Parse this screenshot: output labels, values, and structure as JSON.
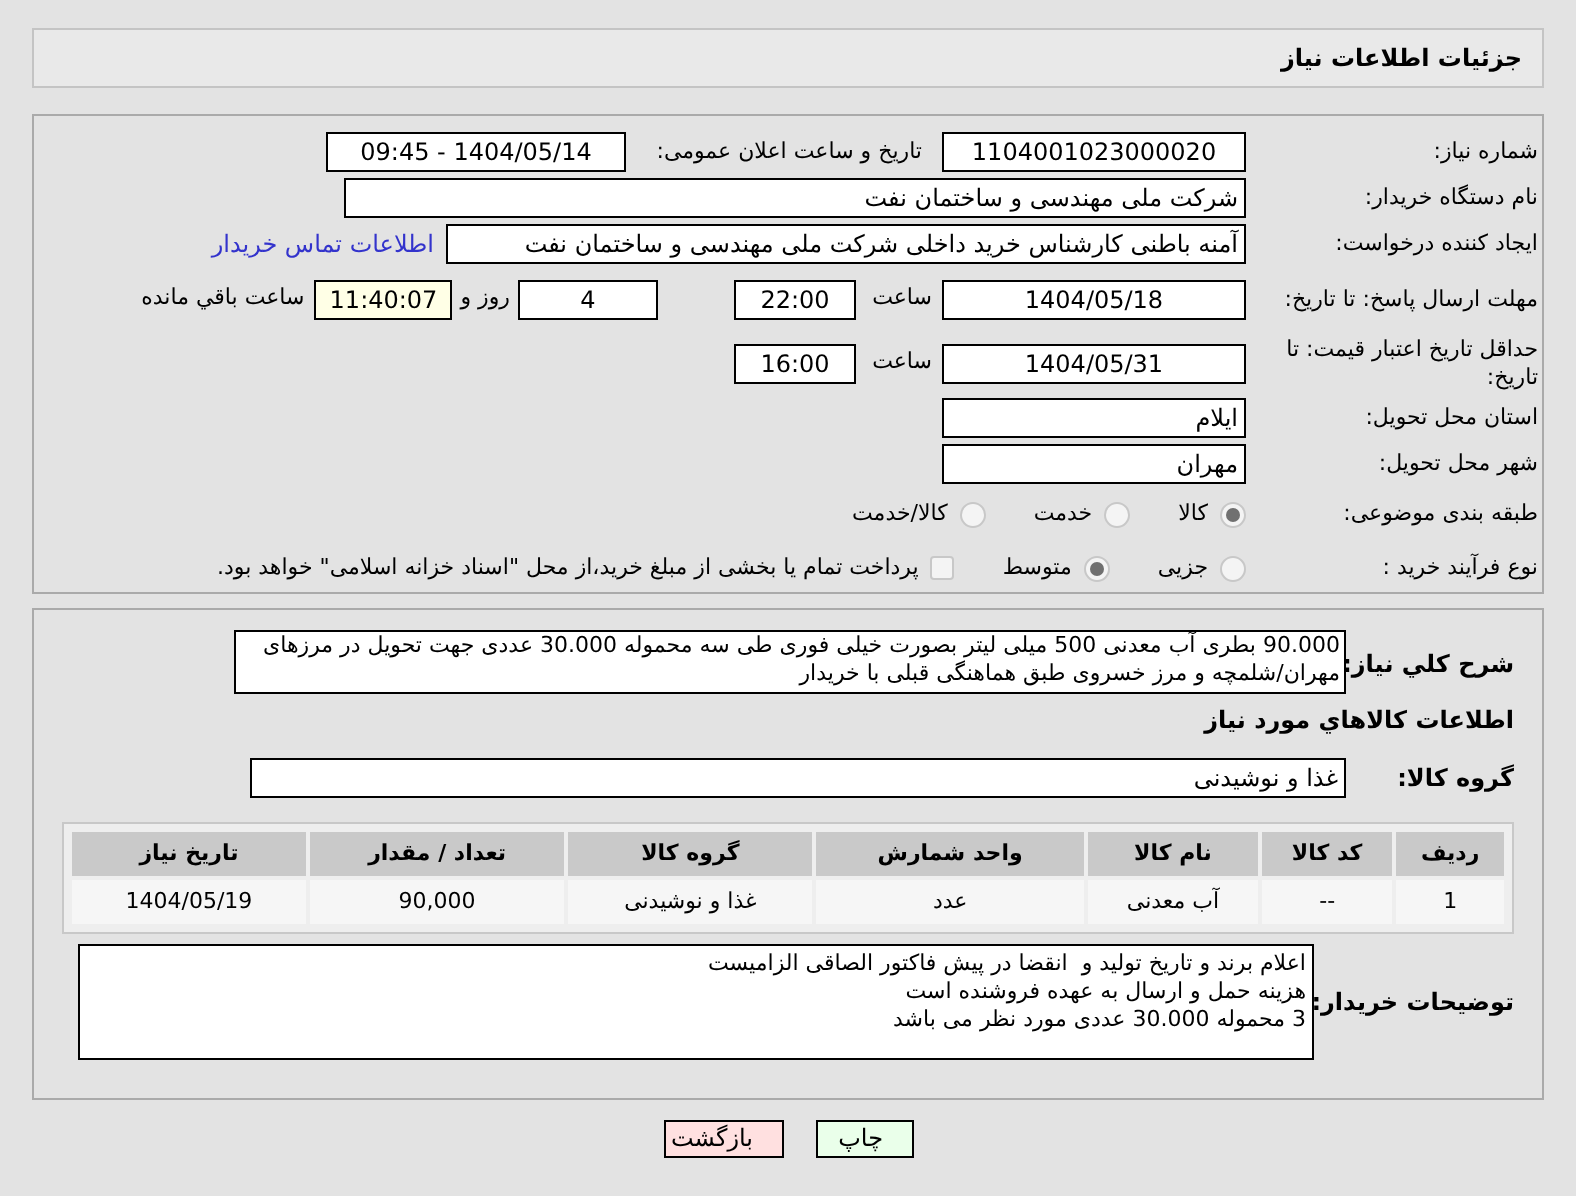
{
  "title": "جزئیات اطلاعات نیاز",
  "need_number": {
    "label": "شماره نیاز:",
    "value": "1104001023000020"
  },
  "announce": {
    "label": "تاریخ و ساعت اعلان عمومی:",
    "value": "1404/05/14 - 09:45"
  },
  "buyer": {
    "label": "نام دستگاه خریدار:",
    "value": "شرکت ملی مهندسی و ساختمان نفت"
  },
  "requester": {
    "label": "ایجاد کننده درخواست:",
    "value": "آمنه باطنی کارشناس خرید داخلی شرکت ملی مهندسی و ساختمان نفت",
    "link": "اطلاعات تماس خریدار"
  },
  "deadline": {
    "label": "مهلت ارسال پاسخ: تا تاریخ:",
    "date": "1404/05/18",
    "time_label": "ساعت",
    "time": "22:00",
    "days": "4",
    "days_label": "روز و",
    "remaining": "11:40:07",
    "remaining_label": "ساعت باقي مانده"
  },
  "validity": {
    "label": "حداقل تاریخ اعتبار قیمت: تا تاریخ:",
    "date": "1404/05/31",
    "time_label": "ساعت",
    "time": "16:00"
  },
  "province": {
    "label": "استان محل تحویل:",
    "value": "ایلام"
  },
  "city": {
    "label": "شهر محل تحویل:",
    "value": "مهران"
  },
  "category": {
    "label": "طبقه بندی موضوعی:",
    "options": [
      {
        "label": "کالا",
        "selected": true
      },
      {
        "label": "خدمت",
        "selected": false
      },
      {
        "label": "کالا/خدمت",
        "selected": false
      }
    ]
  },
  "process": {
    "label": "نوع فرآیند خرید :",
    "options": [
      {
        "label": "جزیی",
        "selected": false
      },
      {
        "label": "متوسط",
        "selected": true
      }
    ],
    "treasury": {
      "label": "پرداخت تمام یا بخشی از مبلغ خرید،از محل \"اسناد خزانه اسلامی\" خواهد بود.",
      "checked": false
    }
  },
  "description": {
    "label": "شرح کلي نياز:",
    "value": "90.000 بطری آب معدنی 500 میلی لیتر بصورت خیلی فوری طی سه محموله  30.000 عددی جهت تحویل در مرزهای مهران/شلمچه و مرز خسروی طبق هماهنگی قبلی با خریدار"
  },
  "goods_heading": "اطلاعات کالاهاي مورد نياز",
  "goods_group": {
    "label": "گروه کالا:",
    "value": "غذا و نوشیدنی"
  },
  "table": {
    "columns": [
      "ردیف",
      "کد کالا",
      "نام کالا",
      "واحد شمارش",
      "گروه کالا",
      "تعداد / مقدار",
      "تاریخ نیاز"
    ],
    "rows": [
      [
        "1",
        "--",
        "آب معدنی",
        "عدد",
        "غذا و نوشیدنی",
        "90,000",
        "1404/05/19"
      ]
    ]
  },
  "buyer_notes": {
    "label": "توضیحات خریدار:",
    "lines": [
      "اعلام برند و تاریخ تولید و  انقضا در پیش فاکتور الصاقی الزامیست",
      "هزینه حمل و ارسال به عهده فروشنده است",
      "3 محموله 30.000 عددی مورد نظر می باشد"
    ]
  },
  "buttons": [
    {
      "label": "چاپ",
      "kind": "print"
    },
    {
      "label": "بازگشت",
      "kind": "back"
    }
  ]
}
